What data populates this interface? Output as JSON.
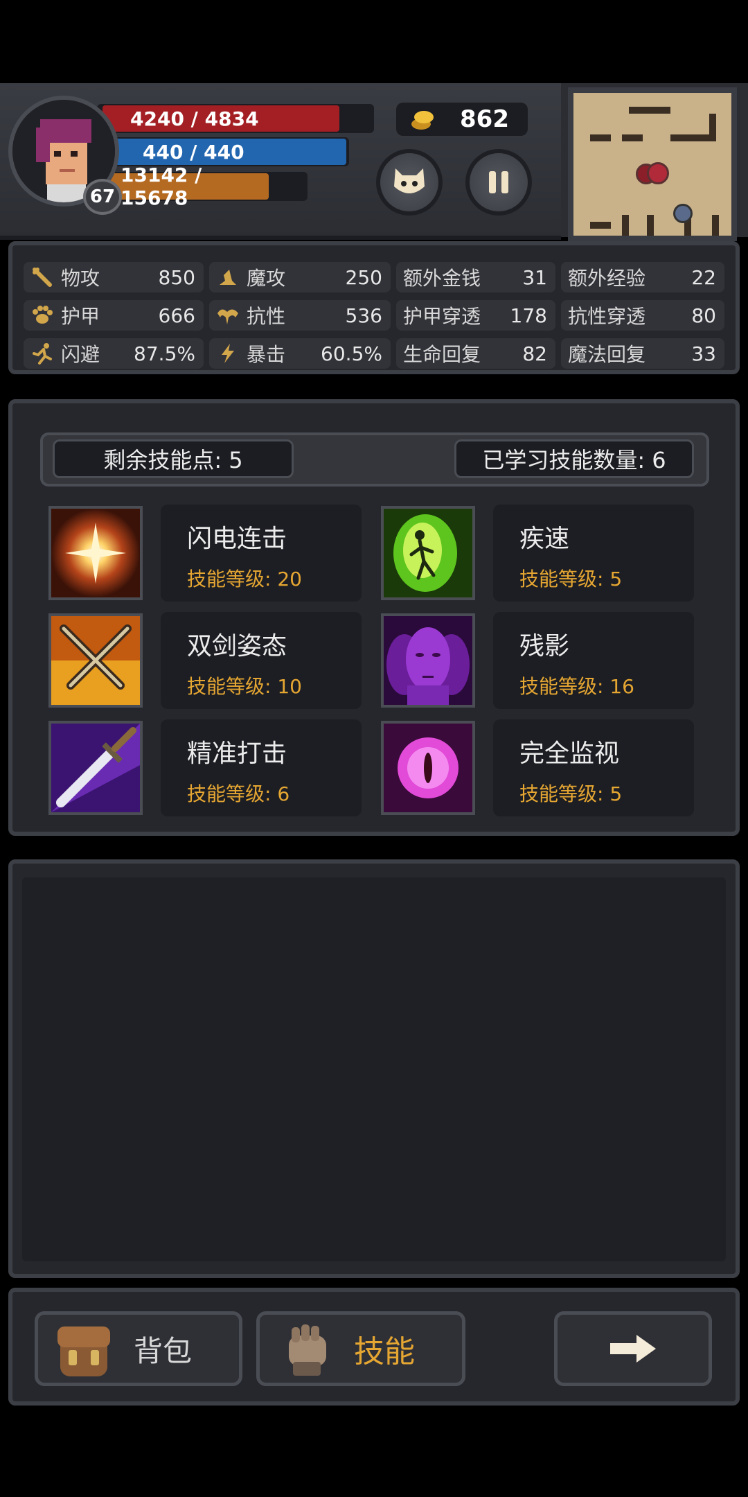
{
  "hud": {
    "hp": "4240 / 4834",
    "hp_fraction": 0.877,
    "mp": "440 / 440",
    "mp_fraction": 1.0,
    "xp": "13142 / 15678",
    "xp_fraction": 0.838,
    "level": "67",
    "gold": "862"
  },
  "stats": [
    {
      "icon": "sword-icon",
      "label": "物攻",
      "value": "850"
    },
    {
      "icon": "magic-hat-icon",
      "label": "魔攻",
      "value": "250"
    },
    {
      "icon": "",
      "label": "额外金钱",
      "value": "31"
    },
    {
      "icon": "",
      "label": "额外经验",
      "value": "22"
    },
    {
      "icon": "paw-icon",
      "label": "护甲",
      "value": "666"
    },
    {
      "icon": "muscle-icon",
      "label": "抗性",
      "value": "536"
    },
    {
      "icon": "",
      "label": "护甲穿透",
      "value": "178"
    },
    {
      "icon": "",
      "label": "抗性穿透",
      "value": "80"
    },
    {
      "icon": "running-icon",
      "label": "闪避",
      "value": "87.5%"
    },
    {
      "icon": "lightning-icon",
      "label": "暴击",
      "value": "60.5%"
    },
    {
      "icon": "",
      "label": "生命回复",
      "value": "82"
    },
    {
      "icon": "",
      "label": "魔法回复",
      "value": "33"
    }
  ],
  "skills_panel": {
    "remaining_points": "剩余技能点: 5",
    "learned_count": "已学习技能数量: 6",
    "skills": [
      {
        "name": "闪电连击",
        "level": "技能等级: 20",
        "icon": "flash-burst-icon"
      },
      {
        "name": "疾速",
        "level": "技能等级: 5",
        "icon": "haste-figure-icon"
      },
      {
        "name": "双剑姿态",
        "level": "技能等级: 10",
        "icon": "crossed-swords-icon"
      },
      {
        "name": "残影",
        "level": "技能等级: 16",
        "icon": "afterimage-face-icon"
      },
      {
        "name": "精准打击",
        "level": "技能等级: 6",
        "icon": "sword-strike-icon"
      },
      {
        "name": "完全监视",
        "level": "技能等级: 5",
        "icon": "watching-eye-icon"
      }
    ]
  },
  "bottom_nav": {
    "bag": "背包",
    "skills": "技能",
    "active_color": "#e5a632"
  }
}
